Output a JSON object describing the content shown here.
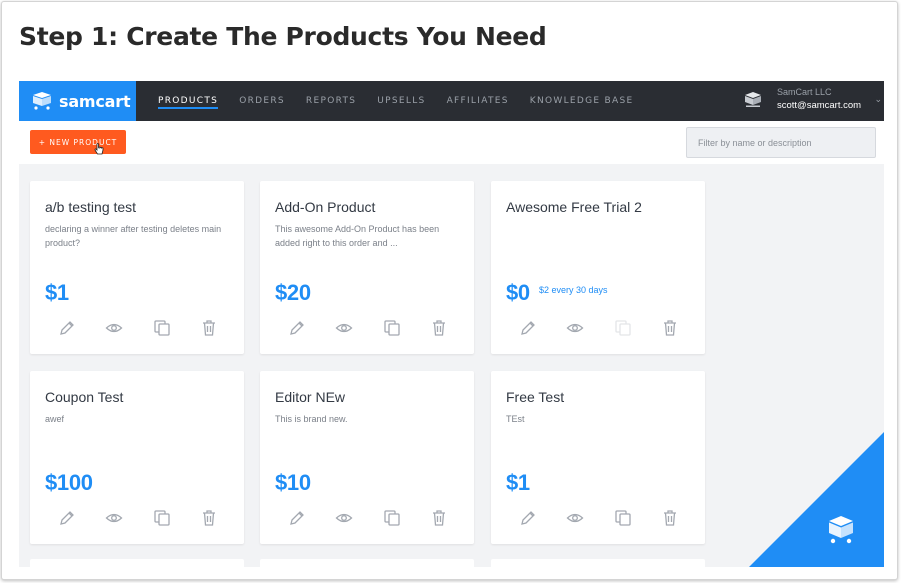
{
  "header": {
    "title": "Step 1: Create The Products You Need"
  },
  "app": {
    "brand": {
      "name": "samcart",
      "color": "#1f8df5",
      "icon": "cart-icon"
    },
    "nav": {
      "items": [
        {
          "label": "PRODUCTS",
          "active": true
        },
        {
          "label": "ORDERS",
          "active": false
        },
        {
          "label": "REPORTS",
          "active": false
        },
        {
          "label": "UPSELLS",
          "active": false
        },
        {
          "label": "AFFILIATES",
          "active": false
        },
        {
          "label": "KNOWLEDGE BASE",
          "active": false
        }
      ]
    },
    "account": {
      "company": "SamCart LLC",
      "email": "scott@samcart.com",
      "icon": "store-icon",
      "chevron": "chevron-down-icon"
    },
    "toolbar": {
      "new_product_label": "+ NEW PRODUCT",
      "new_product_color": "#ff5a1f",
      "filter_placeholder": "Filter by name or description"
    },
    "products": [
      {
        "name": "a/b testing test",
        "description": "declaring a winner after testing deletes main product?",
        "price": "$1",
        "price_note": ""
      },
      {
        "name": "Add-On Product",
        "description": "This awesome Add-On Product has been added right to this order and ...",
        "price": "$20",
        "price_note": ""
      },
      {
        "name": "Awesome Free Trial 2",
        "description": "",
        "price": "$0",
        "price_note": "$2 every 30 days"
      },
      {
        "name": "Coupon Test",
        "description": "awef",
        "price": "$100",
        "price_note": ""
      },
      {
        "name": "Editor NEw",
        "description": "This is brand new.",
        "price": "$10",
        "price_note": ""
      },
      {
        "name": "Free Test",
        "description": "TEst",
        "price": "$1",
        "price_note": ""
      }
    ],
    "card_actions": [
      "edit-icon",
      "view-icon",
      "duplicate-icon",
      "delete-icon"
    ]
  }
}
